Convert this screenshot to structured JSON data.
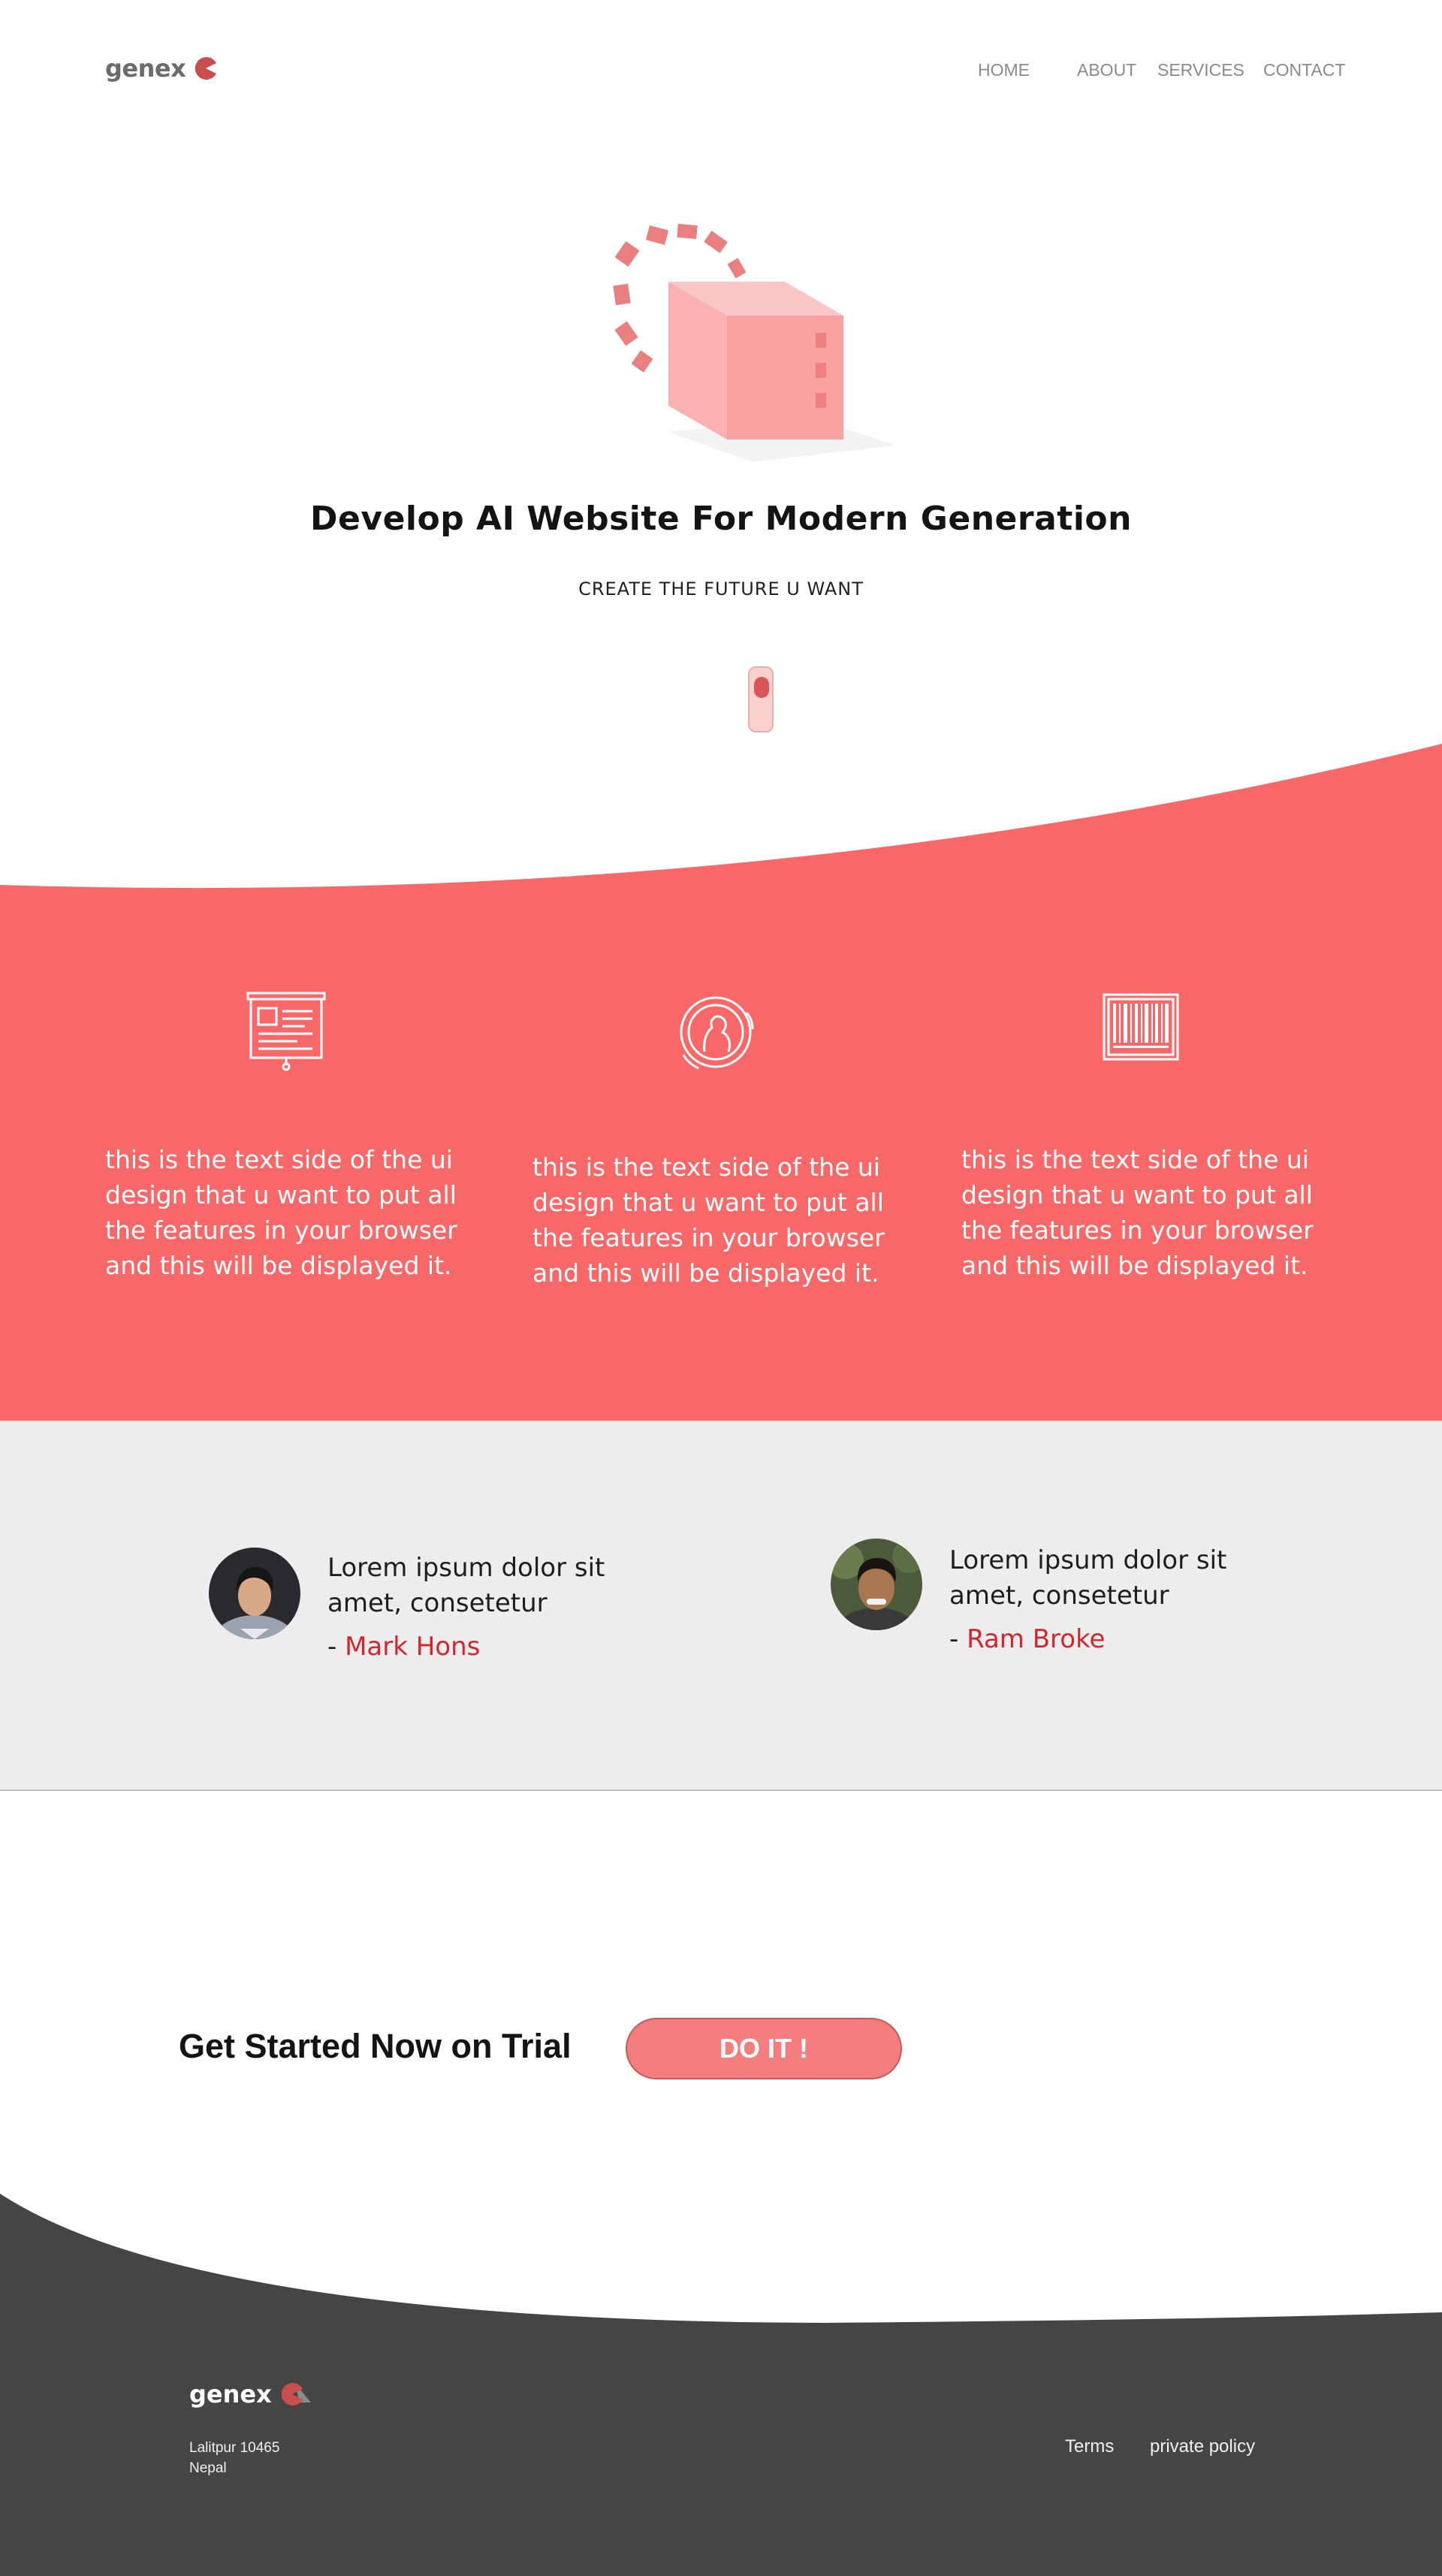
{
  "brand": {
    "name": "genex",
    "accent": "#f86868",
    "logo_color": "#c94f4f"
  },
  "nav": {
    "items": [
      {
        "label": "HOME"
      },
      {
        "label": "ABOUT"
      },
      {
        "label": "SERVICES"
      },
      {
        "label": "CONTACT"
      }
    ]
  },
  "hero": {
    "title": "Develop AI Website For Modern Generation",
    "subtitle": "CREATE THE FUTURE U WANT",
    "illustration": "cube-with-dashed-orbit"
  },
  "features": {
    "background": "#f86868",
    "items": [
      {
        "icon": "presentation-board-icon",
        "text": "this is the text side of the ui design that u want to put all the features in your browser and this will be displayed it."
      },
      {
        "icon": "coin-portrait-icon",
        "text": "this is the text side of the ui design that u want to put all the features in your browser and this will be displayed it."
      },
      {
        "icon": "barcode-icon",
        "text": "this is the text side of the ui design that u want to put all the features in your browser and this will be displayed it."
      }
    ]
  },
  "testimonials": {
    "items": [
      {
        "quote": "Lorem ipsum dolor sit amet, consetetur",
        "dash": "- ",
        "author": "Mark Hons"
      },
      {
        "quote": "Lorem ipsum dolor sit amet, consetetur",
        "dash": "- ",
        "author": "Ram Broke"
      }
    ]
  },
  "cta": {
    "title": "Get Started Now on Trial",
    "button_label": "DO IT !"
  },
  "footer": {
    "background": "#454545",
    "brand": "genex",
    "address_line1": "Lalitpur 10465",
    "address_line2": "Nepal",
    "links": [
      {
        "label": "Terms"
      },
      {
        "label": "private policy"
      }
    ]
  }
}
